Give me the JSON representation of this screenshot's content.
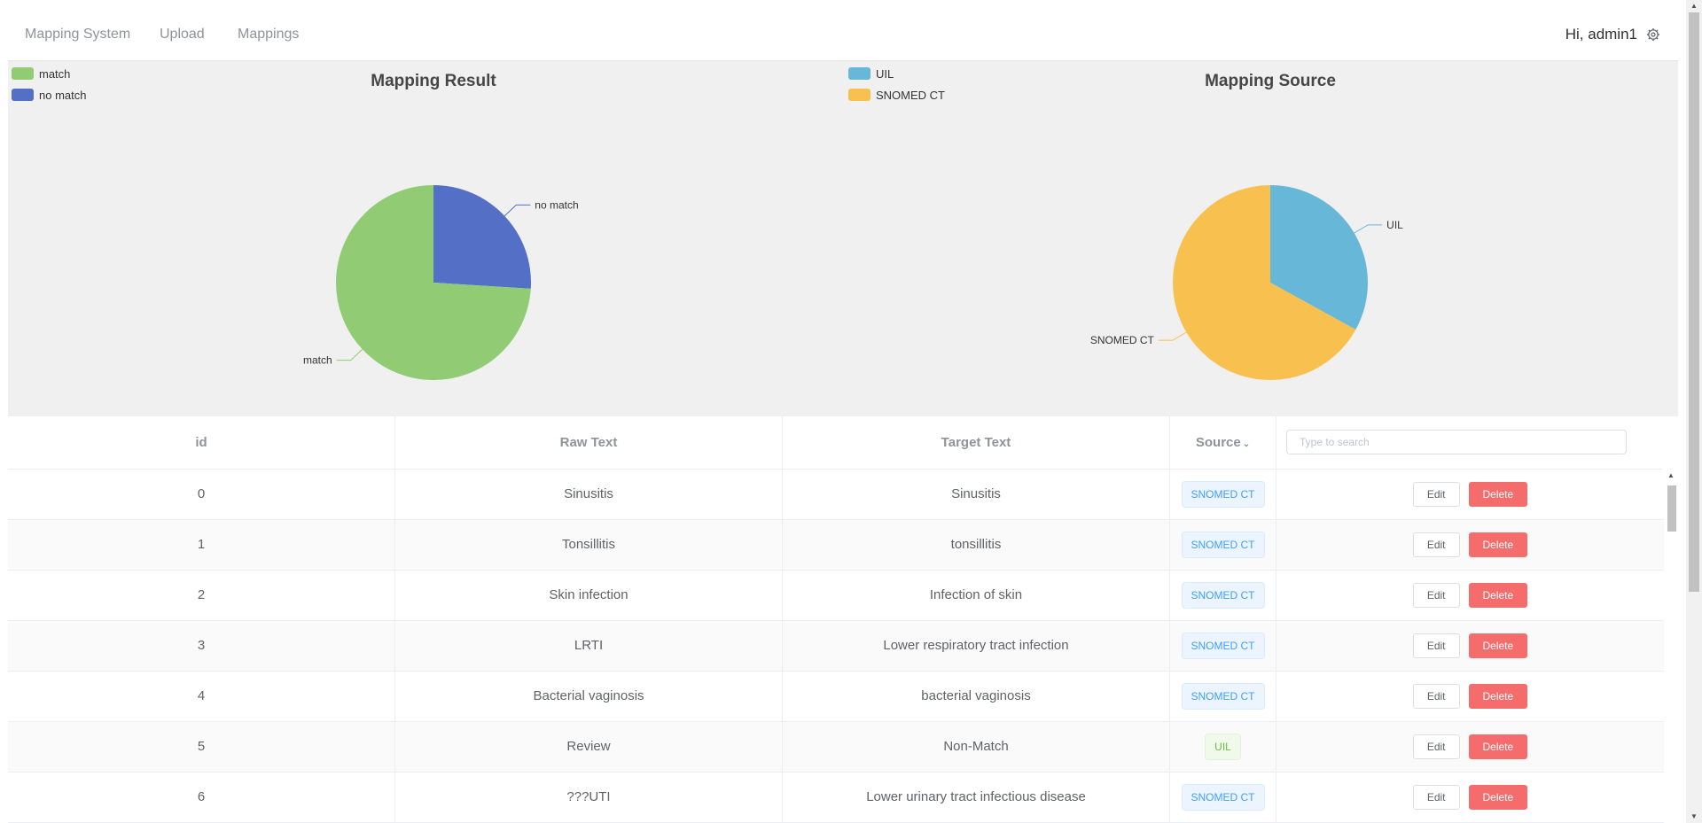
{
  "nav": {
    "brand": "Mapping System",
    "items": [
      "Upload",
      "Mappings"
    ],
    "greeting": "Hi, admin1"
  },
  "charts": [
    {
      "title": "Mapping Result",
      "legend": [
        {
          "name": "match",
          "color": "#91cc75"
        },
        {
          "name": "no match",
          "color": "#5470c6"
        }
      ]
    },
    {
      "title": "Mapping Source",
      "legend": [
        {
          "name": "UIL",
          "color": "#67b7d9"
        },
        {
          "name": "SNOMED CT",
          "color": "#f8c04e"
        }
      ]
    }
  ],
  "chart_data": [
    {
      "type": "pie",
      "title": "Mapping Result",
      "slices": [
        {
          "name": "no match",
          "value": 0.26,
          "color": "#5470c6"
        },
        {
          "name": "match",
          "value": 0.74,
          "color": "#91cc75"
        }
      ]
    },
    {
      "type": "pie",
      "title": "Mapping Source",
      "slices": [
        {
          "name": "UIL",
          "value": 0.33,
          "color": "#67b7d9"
        },
        {
          "name": "SNOMED CT",
          "value": 0.67,
          "color": "#f8c04e"
        }
      ]
    }
  ],
  "table": {
    "headers": {
      "id": "id",
      "raw": "Raw Text",
      "target": "Target Text",
      "source": "Source"
    },
    "search_placeholder": "Type to search",
    "edit_label": "Edit",
    "delete_label": "Delete",
    "rows": [
      {
        "id": "0",
        "raw": "Sinusitis",
        "target": "Sinusitis",
        "source": "SNOMED CT"
      },
      {
        "id": "1",
        "raw": "Tonsillitis",
        "target": "tonsillitis",
        "source": "SNOMED CT"
      },
      {
        "id": "2",
        "raw": "Skin infection",
        "target": "Infection of skin",
        "source": "SNOMED CT"
      },
      {
        "id": "3",
        "raw": "LRTI",
        "target": "Lower respiratory tract infection",
        "source": "SNOMED CT"
      },
      {
        "id": "4",
        "raw": "Bacterial vaginosis",
        "target": "bacterial vaginosis",
        "source": "SNOMED CT"
      },
      {
        "id": "5",
        "raw": "Review",
        "target": "Non-Match",
        "source": "UIL"
      },
      {
        "id": "6",
        "raw": "???UTI",
        "target": "Lower urinary tract infectious disease",
        "source": "SNOMED CT"
      }
    ]
  }
}
